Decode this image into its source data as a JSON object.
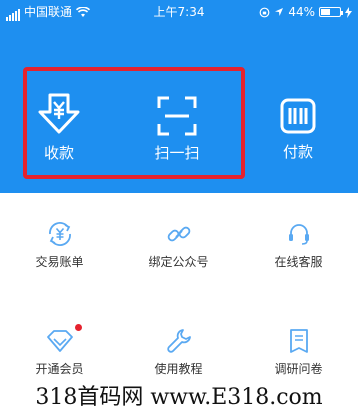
{
  "status_bar": {
    "carrier": "中国联通",
    "time": "上午7:34",
    "battery": "44%"
  },
  "hero": {
    "actions": [
      {
        "label": "收款",
        "icon": "yuan-download-icon"
      },
      {
        "label": "扫一扫",
        "icon": "scan-icon"
      },
      {
        "label": "付款",
        "icon": "barcode-icon"
      }
    ]
  },
  "grid": {
    "items": [
      {
        "label": "交易账单",
        "icon": "yuan-cycle-icon"
      },
      {
        "label": "绑定公众号",
        "icon": "link-icon"
      },
      {
        "label": "在线客服",
        "icon": "headset-icon"
      },
      {
        "label": "开通会员",
        "icon": "diamond-icon"
      },
      {
        "label": "使用教程",
        "icon": "wrench-icon"
      },
      {
        "label": "调研问卷",
        "icon": "survey-icon"
      }
    ]
  },
  "watermark": {
    "text": "318首码网 www.E318.com"
  },
  "colors": {
    "hero_blue": "#1e8ff0",
    "highlight_red": "#e5222e",
    "icon_blue": "#5aa9f2"
  }
}
